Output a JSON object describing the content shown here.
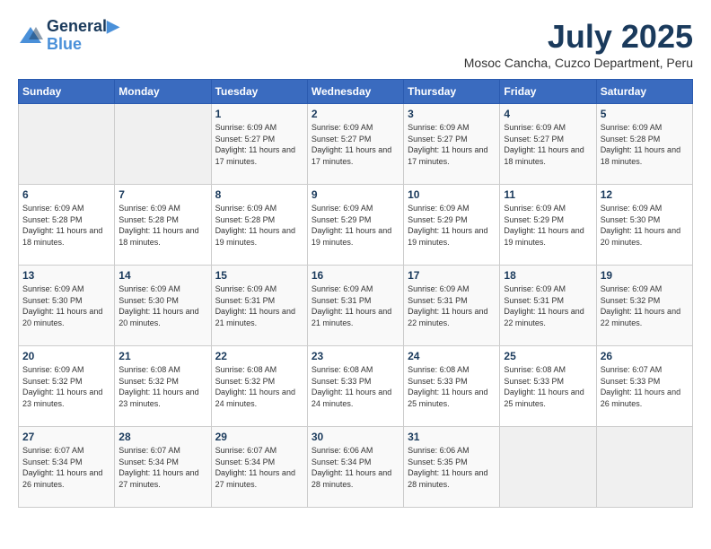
{
  "header": {
    "logo_line1": "General",
    "logo_line2": "Blue",
    "month": "July 2025",
    "location": "Mosoc Cancha, Cuzco Department, Peru"
  },
  "days_of_week": [
    "Sunday",
    "Monday",
    "Tuesday",
    "Wednesday",
    "Thursday",
    "Friday",
    "Saturday"
  ],
  "weeks": [
    [
      {
        "day": "",
        "info": ""
      },
      {
        "day": "",
        "info": ""
      },
      {
        "day": "1",
        "info": "Sunrise: 6:09 AM\nSunset: 5:27 PM\nDaylight: 11 hours and 17 minutes."
      },
      {
        "day": "2",
        "info": "Sunrise: 6:09 AM\nSunset: 5:27 PM\nDaylight: 11 hours and 17 minutes."
      },
      {
        "day": "3",
        "info": "Sunrise: 6:09 AM\nSunset: 5:27 PM\nDaylight: 11 hours and 17 minutes."
      },
      {
        "day": "4",
        "info": "Sunrise: 6:09 AM\nSunset: 5:27 PM\nDaylight: 11 hours and 18 minutes."
      },
      {
        "day": "5",
        "info": "Sunrise: 6:09 AM\nSunset: 5:28 PM\nDaylight: 11 hours and 18 minutes."
      }
    ],
    [
      {
        "day": "6",
        "info": "Sunrise: 6:09 AM\nSunset: 5:28 PM\nDaylight: 11 hours and 18 minutes."
      },
      {
        "day": "7",
        "info": "Sunrise: 6:09 AM\nSunset: 5:28 PM\nDaylight: 11 hours and 18 minutes."
      },
      {
        "day": "8",
        "info": "Sunrise: 6:09 AM\nSunset: 5:28 PM\nDaylight: 11 hours and 19 minutes."
      },
      {
        "day": "9",
        "info": "Sunrise: 6:09 AM\nSunset: 5:29 PM\nDaylight: 11 hours and 19 minutes."
      },
      {
        "day": "10",
        "info": "Sunrise: 6:09 AM\nSunset: 5:29 PM\nDaylight: 11 hours and 19 minutes."
      },
      {
        "day": "11",
        "info": "Sunrise: 6:09 AM\nSunset: 5:29 PM\nDaylight: 11 hours and 19 minutes."
      },
      {
        "day": "12",
        "info": "Sunrise: 6:09 AM\nSunset: 5:30 PM\nDaylight: 11 hours and 20 minutes."
      }
    ],
    [
      {
        "day": "13",
        "info": "Sunrise: 6:09 AM\nSunset: 5:30 PM\nDaylight: 11 hours and 20 minutes."
      },
      {
        "day": "14",
        "info": "Sunrise: 6:09 AM\nSunset: 5:30 PM\nDaylight: 11 hours and 20 minutes."
      },
      {
        "day": "15",
        "info": "Sunrise: 6:09 AM\nSunset: 5:31 PM\nDaylight: 11 hours and 21 minutes."
      },
      {
        "day": "16",
        "info": "Sunrise: 6:09 AM\nSunset: 5:31 PM\nDaylight: 11 hours and 21 minutes."
      },
      {
        "day": "17",
        "info": "Sunrise: 6:09 AM\nSunset: 5:31 PM\nDaylight: 11 hours and 22 minutes."
      },
      {
        "day": "18",
        "info": "Sunrise: 6:09 AM\nSunset: 5:31 PM\nDaylight: 11 hours and 22 minutes."
      },
      {
        "day": "19",
        "info": "Sunrise: 6:09 AM\nSunset: 5:32 PM\nDaylight: 11 hours and 22 minutes."
      }
    ],
    [
      {
        "day": "20",
        "info": "Sunrise: 6:09 AM\nSunset: 5:32 PM\nDaylight: 11 hours and 23 minutes."
      },
      {
        "day": "21",
        "info": "Sunrise: 6:08 AM\nSunset: 5:32 PM\nDaylight: 11 hours and 23 minutes."
      },
      {
        "day": "22",
        "info": "Sunrise: 6:08 AM\nSunset: 5:32 PM\nDaylight: 11 hours and 24 minutes."
      },
      {
        "day": "23",
        "info": "Sunrise: 6:08 AM\nSunset: 5:33 PM\nDaylight: 11 hours and 24 minutes."
      },
      {
        "day": "24",
        "info": "Sunrise: 6:08 AM\nSunset: 5:33 PM\nDaylight: 11 hours and 25 minutes."
      },
      {
        "day": "25",
        "info": "Sunrise: 6:08 AM\nSunset: 5:33 PM\nDaylight: 11 hours and 25 minutes."
      },
      {
        "day": "26",
        "info": "Sunrise: 6:07 AM\nSunset: 5:33 PM\nDaylight: 11 hours and 26 minutes."
      }
    ],
    [
      {
        "day": "27",
        "info": "Sunrise: 6:07 AM\nSunset: 5:34 PM\nDaylight: 11 hours and 26 minutes."
      },
      {
        "day": "28",
        "info": "Sunrise: 6:07 AM\nSunset: 5:34 PM\nDaylight: 11 hours and 27 minutes."
      },
      {
        "day": "29",
        "info": "Sunrise: 6:07 AM\nSunset: 5:34 PM\nDaylight: 11 hours and 27 minutes."
      },
      {
        "day": "30",
        "info": "Sunrise: 6:06 AM\nSunset: 5:34 PM\nDaylight: 11 hours and 28 minutes."
      },
      {
        "day": "31",
        "info": "Sunrise: 6:06 AM\nSunset: 5:35 PM\nDaylight: 11 hours and 28 minutes."
      },
      {
        "day": "",
        "info": ""
      },
      {
        "day": "",
        "info": ""
      }
    ]
  ]
}
